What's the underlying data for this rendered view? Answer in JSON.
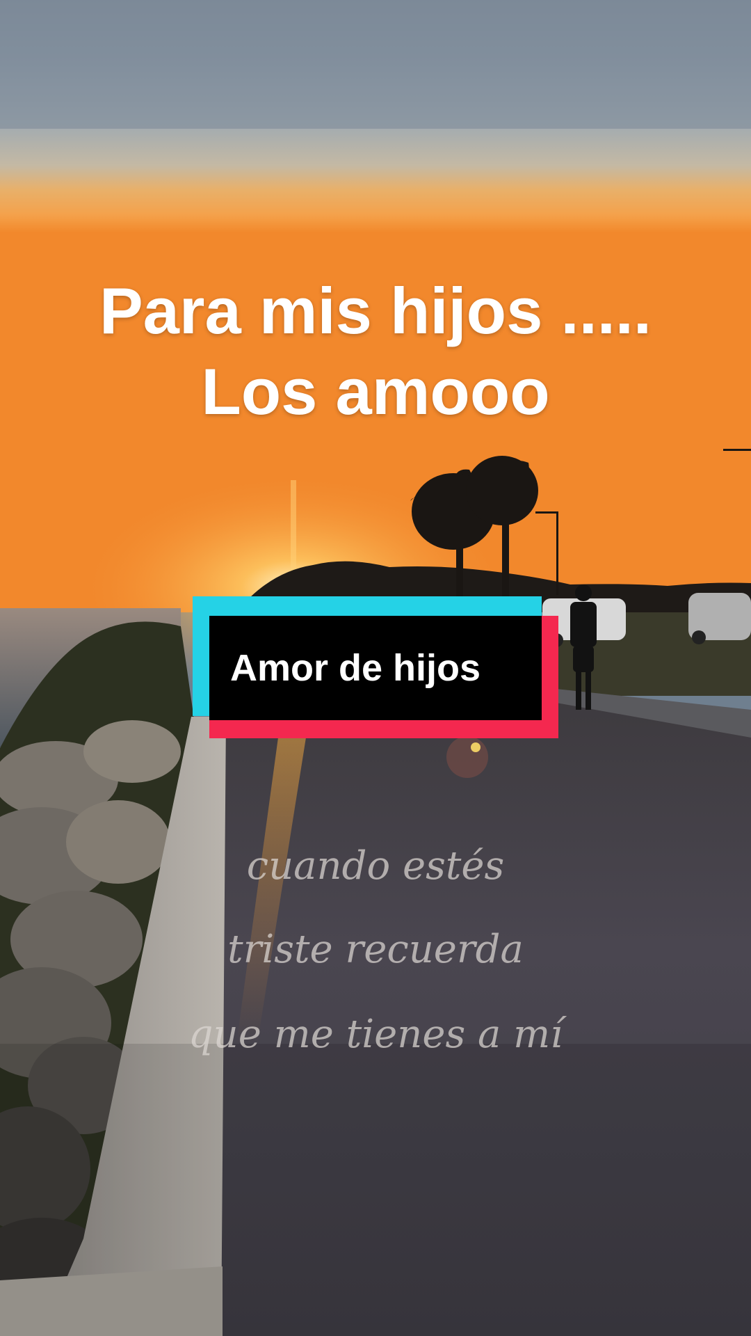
{
  "overlay": {
    "title_line1": "Para mis hijos .....",
    "title_line2": "Los amooo",
    "card_label": "Amor de hijos",
    "lyrics": [
      "cuando estés",
      "triste recuerda",
      "que me tienes a mí"
    ]
  },
  "scene": {
    "description_icons": [
      "sun",
      "palm-trees",
      "ocean",
      "road",
      "rocks",
      "curb",
      "person-walking",
      "parked-cars",
      "street-lamp"
    ]
  },
  "colors": {
    "card_cyan": "#25d2e6",
    "card_red": "#f4284f",
    "card_black": "#000000",
    "title": "#ffffff"
  }
}
